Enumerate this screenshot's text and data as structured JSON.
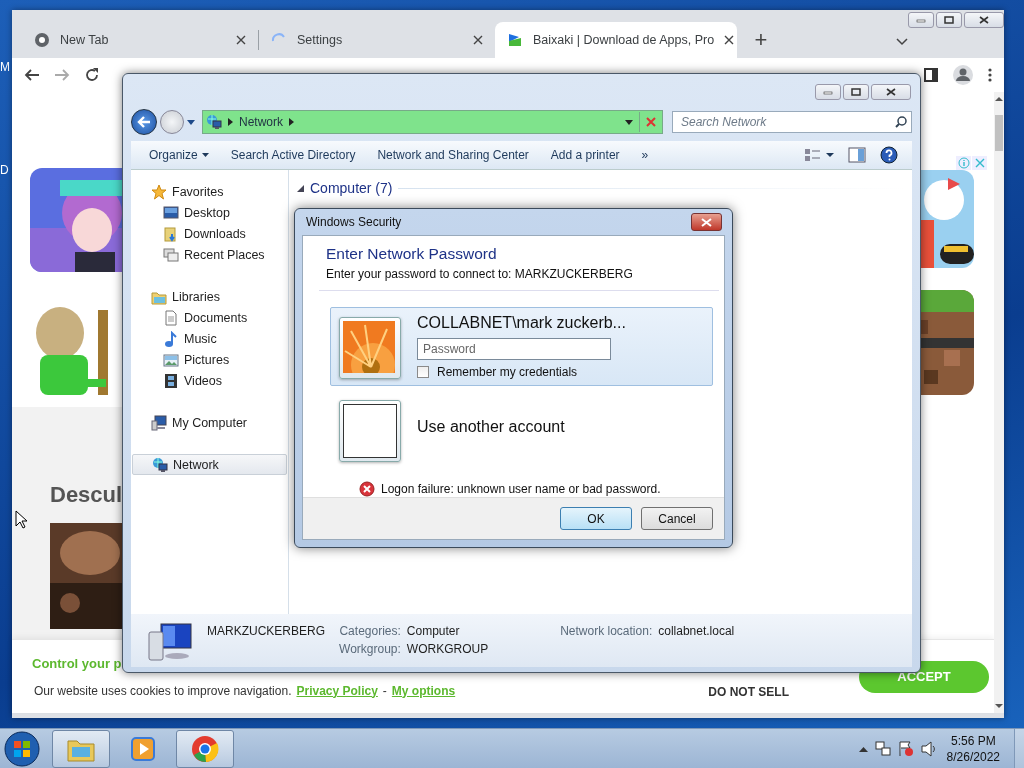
{
  "desktop": {
    "icon_labels": [
      "M",
      "D"
    ]
  },
  "browser": {
    "tabs": [
      {
        "title": "New Tab",
        "kind": "chrome",
        "selected": false
      },
      {
        "title": "Settings",
        "kind": "loading",
        "selected": false
      },
      {
        "title": "Baixaki | Download de Apps, Pro",
        "kind": "site",
        "selected": true
      }
    ],
    "new_tab": "+",
    "page": {
      "heading": "Descul",
      "cookie_banner": {
        "title": "Control your p",
        "text": "Our website uses cookies to improve navigation.",
        "links": [
          "Privacy Policy",
          "My options"
        ],
        "separator": "-",
        "do_not_sell": "DO NOT SELL",
        "accept": "ACCEPT"
      }
    }
  },
  "explorer": {
    "address": [
      "Network"
    ],
    "search_placeholder": "Search Network",
    "toolbar": [
      "Organize",
      "Search Active Directory",
      "Network and Sharing Center",
      "Add a printer"
    ],
    "more": "»",
    "nav": [
      {
        "label": "Favorites",
        "kind": "star",
        "selected": false,
        "children": [
          {
            "label": "Desktop",
            "kind": "desktop",
            "selected": false
          },
          {
            "label": "Downloads",
            "kind": "downloads",
            "selected": false
          },
          {
            "label": "Recent Places",
            "kind": "recent",
            "selected": false
          }
        ]
      },
      {
        "label": "Libraries",
        "kind": "library",
        "selected": false,
        "children": [
          {
            "label": "Documents",
            "kind": "document",
            "selected": false
          },
          {
            "label": "Music",
            "kind": "music",
            "selected": false
          },
          {
            "label": "Pictures",
            "kind": "pictures",
            "selected": false
          },
          {
            "label": "Videos",
            "kind": "videos",
            "selected": false
          }
        ]
      },
      {
        "label": "My Computer",
        "kind": "computer",
        "selected": false
      },
      {
        "label": "Network",
        "kind": "network",
        "selected": true
      }
    ],
    "group": "Computer (7)",
    "details": {
      "name": "MARKZUCKERBERG",
      "fields": [
        {
          "label": "Categories:",
          "value": "Computer"
        },
        {
          "label": "Workgroup:",
          "value": "WORKGROUP"
        },
        {
          "label": "Network location:",
          "value": "collabnet.local"
        }
      ]
    }
  },
  "dialog": {
    "title": "Windows Security",
    "heading": "Enter Network Password",
    "prompt": "Enter your password to connect to: MARKZUCKERBERG",
    "accounts": [
      {
        "kind": "user",
        "name": "COLLABNET\\mark zuckerb...",
        "selected": true,
        "password_placeholder": "Password",
        "remember": {
          "label": "Remember my credentials",
          "checked": false
        }
      },
      {
        "kind": "other",
        "name": "Use another account",
        "selected": false
      }
    ],
    "error": "Logon failure: unknown user name or bad password.",
    "buttons": [
      {
        "label": "OK",
        "default": true
      },
      {
        "label": "Cancel",
        "default": false
      }
    ]
  },
  "taskbar": {
    "apps": [
      {
        "kind": "explorer",
        "open": true
      },
      {
        "kind": "media",
        "open": false
      },
      {
        "kind": "chrome",
        "open": true
      }
    ],
    "time": "5:56 PM",
    "date": "8/26/2022"
  }
}
